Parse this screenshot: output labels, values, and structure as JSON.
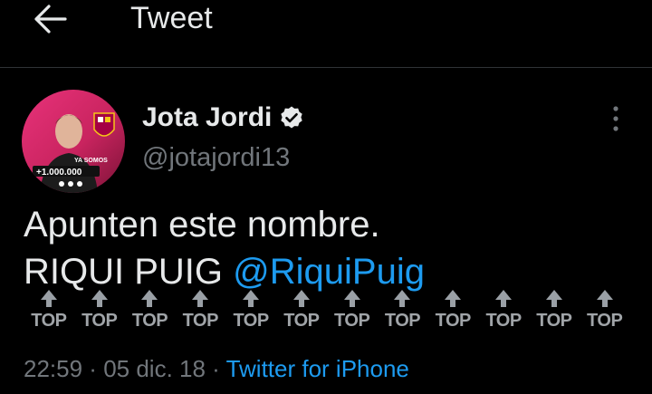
{
  "header": {
    "title": "Tweet",
    "back_icon": "arrow-left-icon"
  },
  "author": {
    "display_name": "Jota Jordi",
    "handle": "@jotajordi13",
    "verified_icon": "verified-badge-icon",
    "avatar": {
      "overlay_line1": "YA SOMOS",
      "overlay_line2": "+1.000.000"
    }
  },
  "tweet": {
    "line1": "Apunten este nombre.",
    "line2_text": "RIQUI PUIG ",
    "mention": "@RiquiPuig",
    "top_label": "TOP",
    "top_count": 12
  },
  "meta": {
    "time": "22:59",
    "sep1": " · ",
    "date": "05 dic. 18",
    "sep2": " · ",
    "source": "Twitter for iPhone"
  },
  "colors": {
    "background": "#000000",
    "text": "#e7e9ea",
    "secondary": "#71767b",
    "accent": "#1d9bf0"
  }
}
